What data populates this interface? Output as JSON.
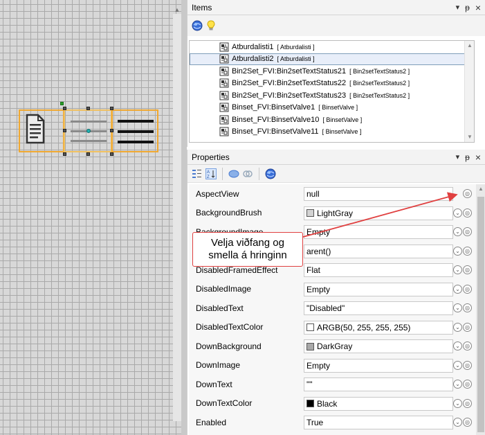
{
  "items_panel": {
    "title": "Items",
    "pin_glyph": "▾",
    "close_glyph": "×",
    "pin_icon_glyph": "𝟭",
    "toolbar_icons": [
      "globe-icon",
      "lightbulb-icon"
    ],
    "items": [
      {
        "name": "Atburdalisti1",
        "type": "[ Atburdalisti ]"
      },
      {
        "name": "Atburdalisti2",
        "type": "[ Atburdalisti ]"
      },
      {
        "name": "Bin2Set_FVI:Bin2setTextStatus21",
        "type": "[ Bin2setTextStatus2 ]"
      },
      {
        "name": "Bin2Set_FVI:Bin2setTextStatus22",
        "type": "[ Bin2setTextStatus2 ]"
      },
      {
        "name": "Bin2Set_FVI:Bin2setTextStatus23",
        "type": "[ Bin2setTextStatus2 ]"
      },
      {
        "name": "Binset_FVI:BinsetValve1",
        "type": "[ BinsetValve ]"
      },
      {
        "name": "Binset_FVI:BinsetValve10",
        "type": "[ BinsetValve ]"
      },
      {
        "name": "Binset_FVI:BinsetValve11",
        "type": "[ BinsetValve ]"
      }
    ],
    "selected_index": 1
  },
  "properties_panel": {
    "title": "Properties",
    "toolbar_icons": [
      "categorized-icon",
      "alphabetical-icon",
      "properties-icon",
      "events-icon",
      "globe-icon"
    ],
    "rows": [
      {
        "name": "AspectView",
        "value": "null",
        "swatch": null
      },
      {
        "name": "BackgroundBrush",
        "value": "LightGray",
        "swatch": "#d3d3d3"
      },
      {
        "name": "BackgroundImage",
        "value": "Empty",
        "swatch": null
      },
      {
        "name": "",
        "value": "arent()",
        "swatch": null
      },
      {
        "name": "DisabledFramedEffect",
        "value": "Flat",
        "swatch": null
      },
      {
        "name": "DisabledImage",
        "value": "Empty",
        "swatch": null
      },
      {
        "name": "DisabledText",
        "value": "\"Disabled\"",
        "swatch": null
      },
      {
        "name": "DisabledTextColor",
        "value": "ARGB(50, 255, 255, 255)",
        "swatch": "#ffffff"
      },
      {
        "name": "DownBackground",
        "value": "DarkGray",
        "swatch": "#a9a9a9"
      },
      {
        "name": "DownImage",
        "value": "Empty",
        "swatch": null
      },
      {
        "name": "DownText",
        "value": "\"\"",
        "swatch": null
      },
      {
        "name": "DownTextColor",
        "value": "Black",
        "swatch": "#000000"
      },
      {
        "name": "Enabled",
        "value": "True",
        "swatch": null
      }
    ]
  },
  "callout": {
    "line1": "Velja viðfang og",
    "line2": "smella á hringinn"
  },
  "colors": {
    "selection": "#f0a830",
    "callout_border": "#e04040",
    "arrow": "#e04040"
  }
}
